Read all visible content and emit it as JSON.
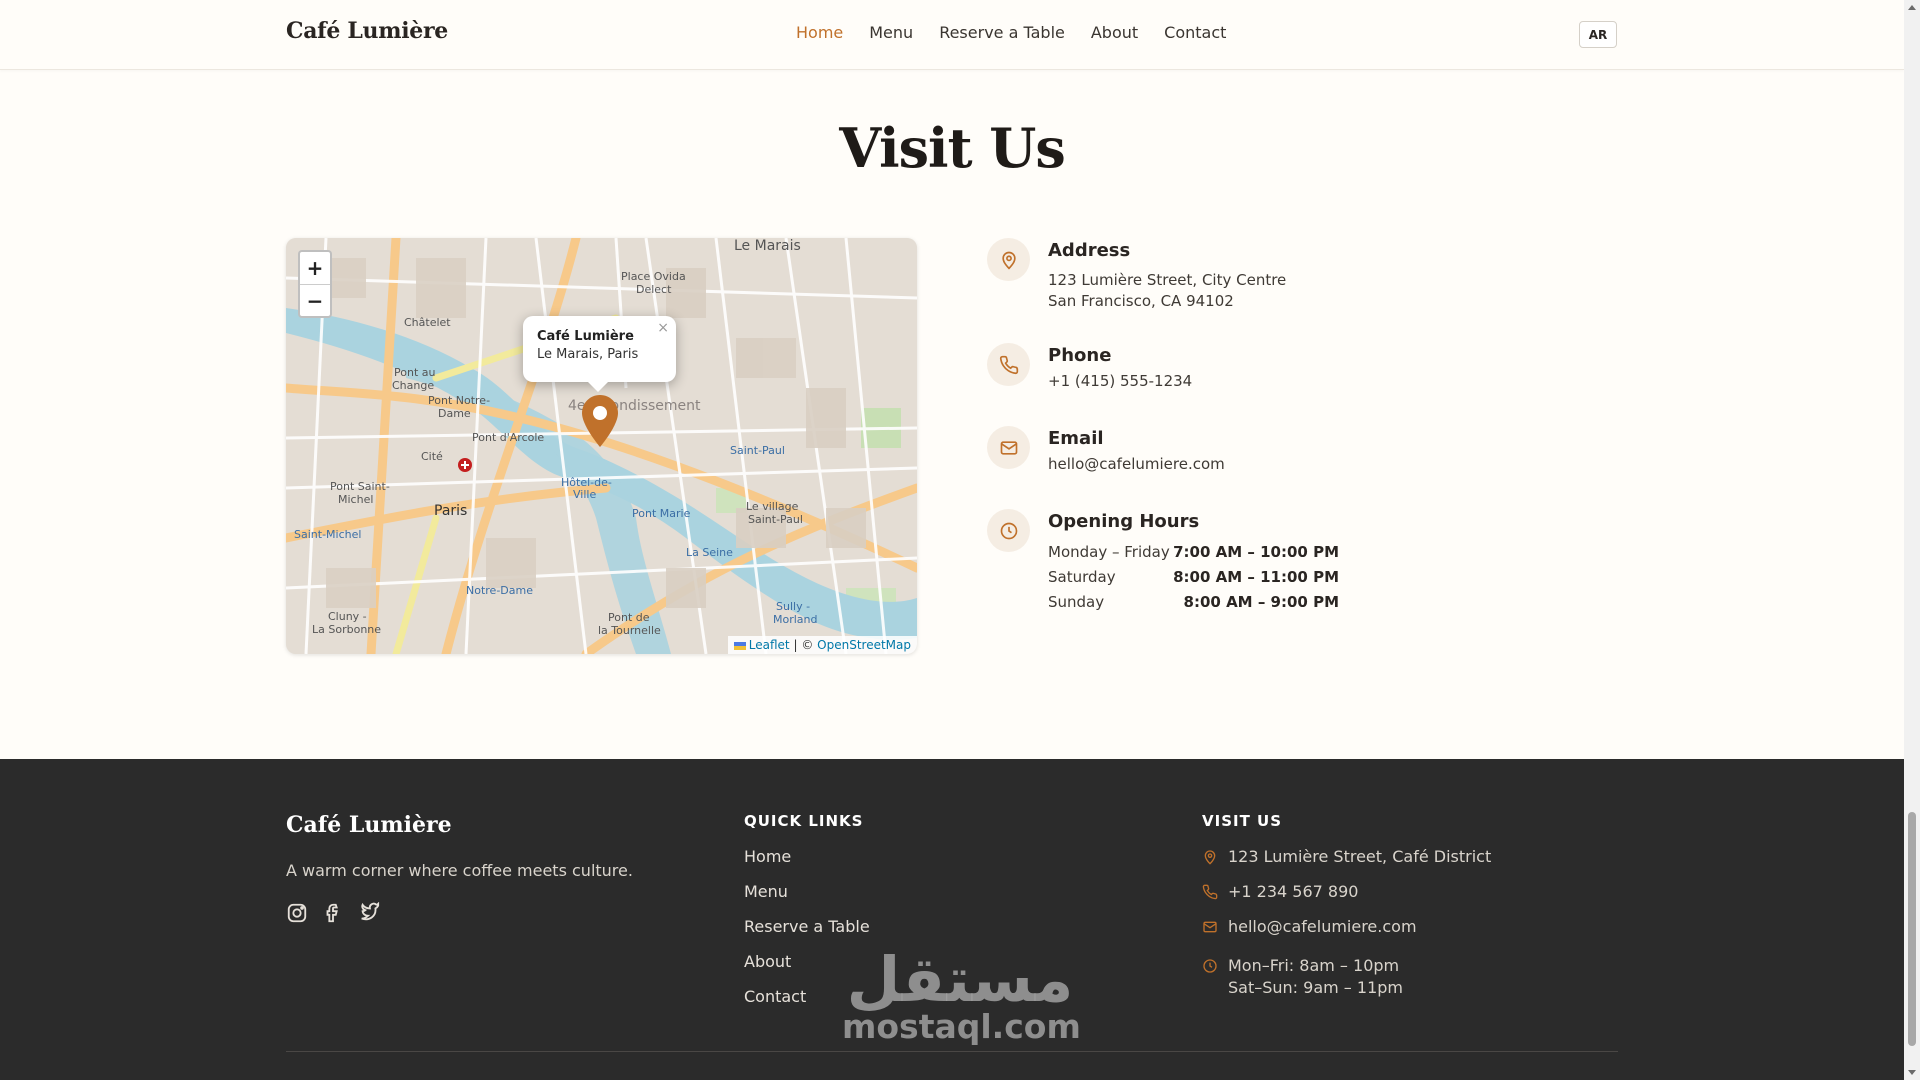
{
  "header": {
    "brand": "Café Lumière",
    "nav": [
      {
        "label": "Home",
        "active": true
      },
      {
        "label": "Menu",
        "active": false
      },
      {
        "label": "Reserve a Table",
        "active": false
      },
      {
        "label": "About",
        "active": false
      },
      {
        "label": "Contact",
        "active": false
      }
    ],
    "lang_button": "AR"
  },
  "visit": {
    "title": "Visit Us",
    "map": {
      "zoom_in": "+",
      "zoom_out": "−",
      "popup_title": "Café Lumière",
      "popup_subtitle": "Le Marais, Paris",
      "popup_close": "×",
      "attribution_leaflet": "Leaflet",
      "attribution_sep": "| ©",
      "attribution_osm": "OpenStreetMap",
      "place_labels": [
        "Le Marais",
        "Place Ovida Delect",
        "Châtelet",
        "Pont au Change",
        "Pont Notre-Dame",
        "Pont d'Arcole",
        "Cité",
        "Paris",
        "Pont Saint-Michel",
        "Saint-Michel",
        "Notre-Dame",
        "Hôtel-de-Ville",
        "Pont Marie",
        "Saint-Paul",
        "Le village Saint-Paul",
        "Sully - Morland",
        "Pont de la Tournelle",
        "Cluny - La Sorbonne",
        "4e Arrondissement",
        "La Seine"
      ]
    },
    "address": {
      "title": "Address",
      "line1": "123 Lumière Street, City Centre",
      "line2": "San Francisco, CA 94102"
    },
    "phone": {
      "title": "Phone",
      "value": "+1 (415) 555-1234"
    },
    "email": {
      "title": "Email",
      "value": "hello@cafelumiere.com"
    },
    "hours": {
      "title": "Opening Hours",
      "rows": [
        {
          "day": "Monday – Friday",
          "time": "7:00 AM – 10:00 PM"
        },
        {
          "day": "Saturday",
          "time": "8:00 AM – 11:00 PM"
        },
        {
          "day": "Sunday",
          "time": "8:00 AM – 9:00 PM"
        }
      ]
    }
  },
  "footer": {
    "brand": "Café Lumière",
    "tagline": "A warm corner where coffee meets culture.",
    "quick_links_title": "QUICK LINKS",
    "quick_links": [
      "Home",
      "Menu",
      "Reserve a Table",
      "About",
      "Contact"
    ],
    "visit_title": "VISIT US",
    "visit_address": "123 Lumière Street, Café District",
    "visit_phone": "+1 234 567 890",
    "visit_email": "hello@cafelumiere.com",
    "visit_hours_1": "Mon–Fri: 8am – 10pm",
    "visit_hours_2": "Sat–Sun: 9am – 11pm"
  },
  "watermark": {
    "arabic": "مستقل",
    "latin": "mostaql.com"
  },
  "colors": {
    "accent": "#c0712b",
    "footer_bg": "#2b2b2b",
    "page_bg": "#fffdf9",
    "icon_bg": "#f5ede3"
  }
}
